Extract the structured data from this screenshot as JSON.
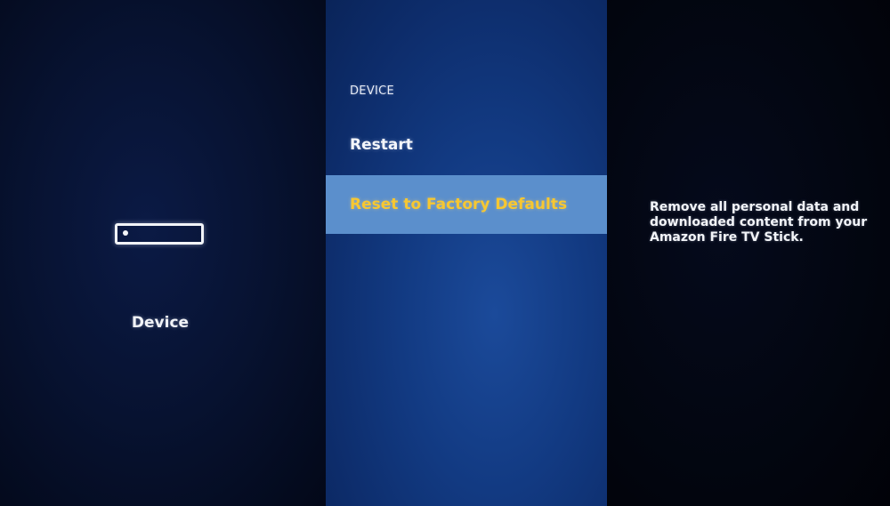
{
  "left_pane": {
    "icon": "streaming-stick-icon",
    "label": "Device"
  },
  "menu": {
    "header": "DEVICE",
    "items": [
      {
        "label": "Restart",
        "selected": false
      },
      {
        "label": "Reset to Factory Defaults",
        "selected": true
      }
    ]
  },
  "description": {
    "text": "Remove all personal data and downloaded content from your Amazon Fire TV Stick."
  },
  "colors": {
    "selected_bg": "#5b8fcc",
    "selected_text": "#f7c731",
    "menu_bg": "#123a82"
  }
}
